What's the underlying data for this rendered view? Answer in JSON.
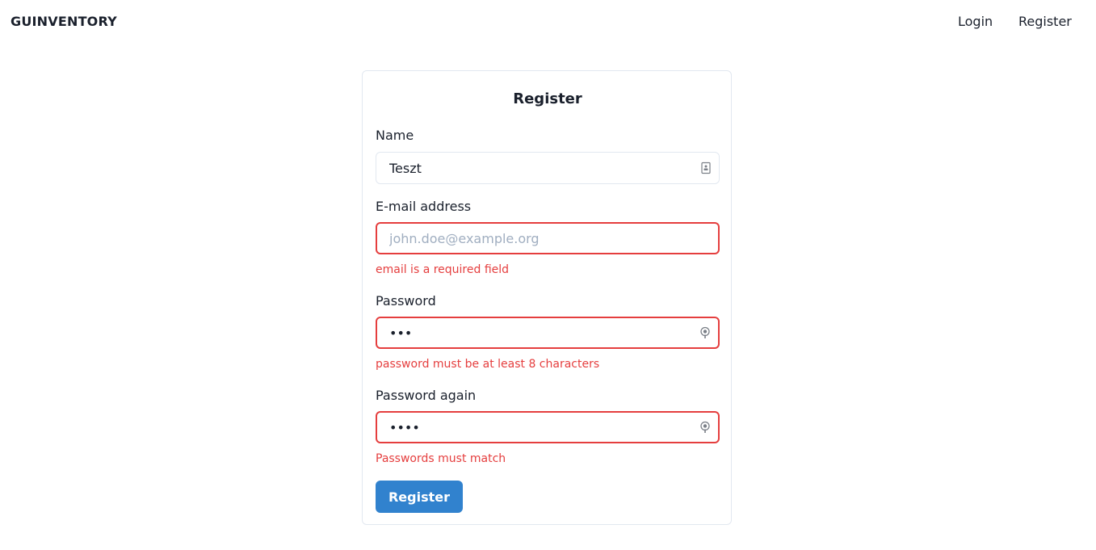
{
  "nav": {
    "brand": "GUINVENTORY",
    "links": [
      {
        "label": "Login"
      },
      {
        "label": "Register"
      }
    ]
  },
  "form": {
    "title": "Register",
    "name": {
      "label": "Name",
      "value": "Teszt",
      "placeholder": "",
      "icon": "contact-card-icon"
    },
    "email": {
      "label": "E-mail address",
      "value": "",
      "placeholder": "john.doe@example.org",
      "error": "email is a required field"
    },
    "password": {
      "label": "Password",
      "value": "abc",
      "icon": "password-key-icon",
      "error": "password must be at least 8 characters"
    },
    "password_again": {
      "label": "Password again",
      "value": "abcd",
      "icon": "password-key-icon",
      "error": "Passwords must match"
    },
    "submit_label": "Register"
  },
  "colors": {
    "accent": "#3182ce",
    "error": "#e53e3e",
    "border": "#e2e8f0"
  }
}
